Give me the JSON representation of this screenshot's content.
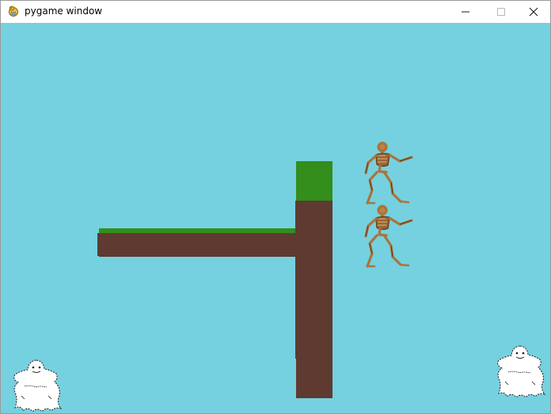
{
  "window": {
    "title": "pygame window",
    "icon": "pygame-snake-icon",
    "controls": {
      "minimize_icon": "minimize-icon",
      "maximize_icon": "maximize-icon",
      "close_icon": "close-icon"
    }
  },
  "game": {
    "background_color": "#75d1df",
    "platforms": [
      {
        "kind": "horizontal-ledge",
        "grass_color": "#338e1c",
        "dirt_color": "#5f3a31"
      },
      {
        "kind": "vertical-pillar",
        "grass_color": "#338e1c",
        "dirt_color": "#5f3a31"
      }
    ],
    "enemies": [
      {
        "kind": "skeleton",
        "icon": "skeleton-sprite",
        "color": "#a9743e"
      },
      {
        "kind": "skeleton",
        "icon": "skeleton-sprite",
        "color": "#a9743e"
      }
    ],
    "ghosts": [
      {
        "kind": "ghost",
        "icon": "ghost-sprite"
      },
      {
        "kind": "ghost",
        "icon": "ghost-sprite"
      }
    ]
  }
}
